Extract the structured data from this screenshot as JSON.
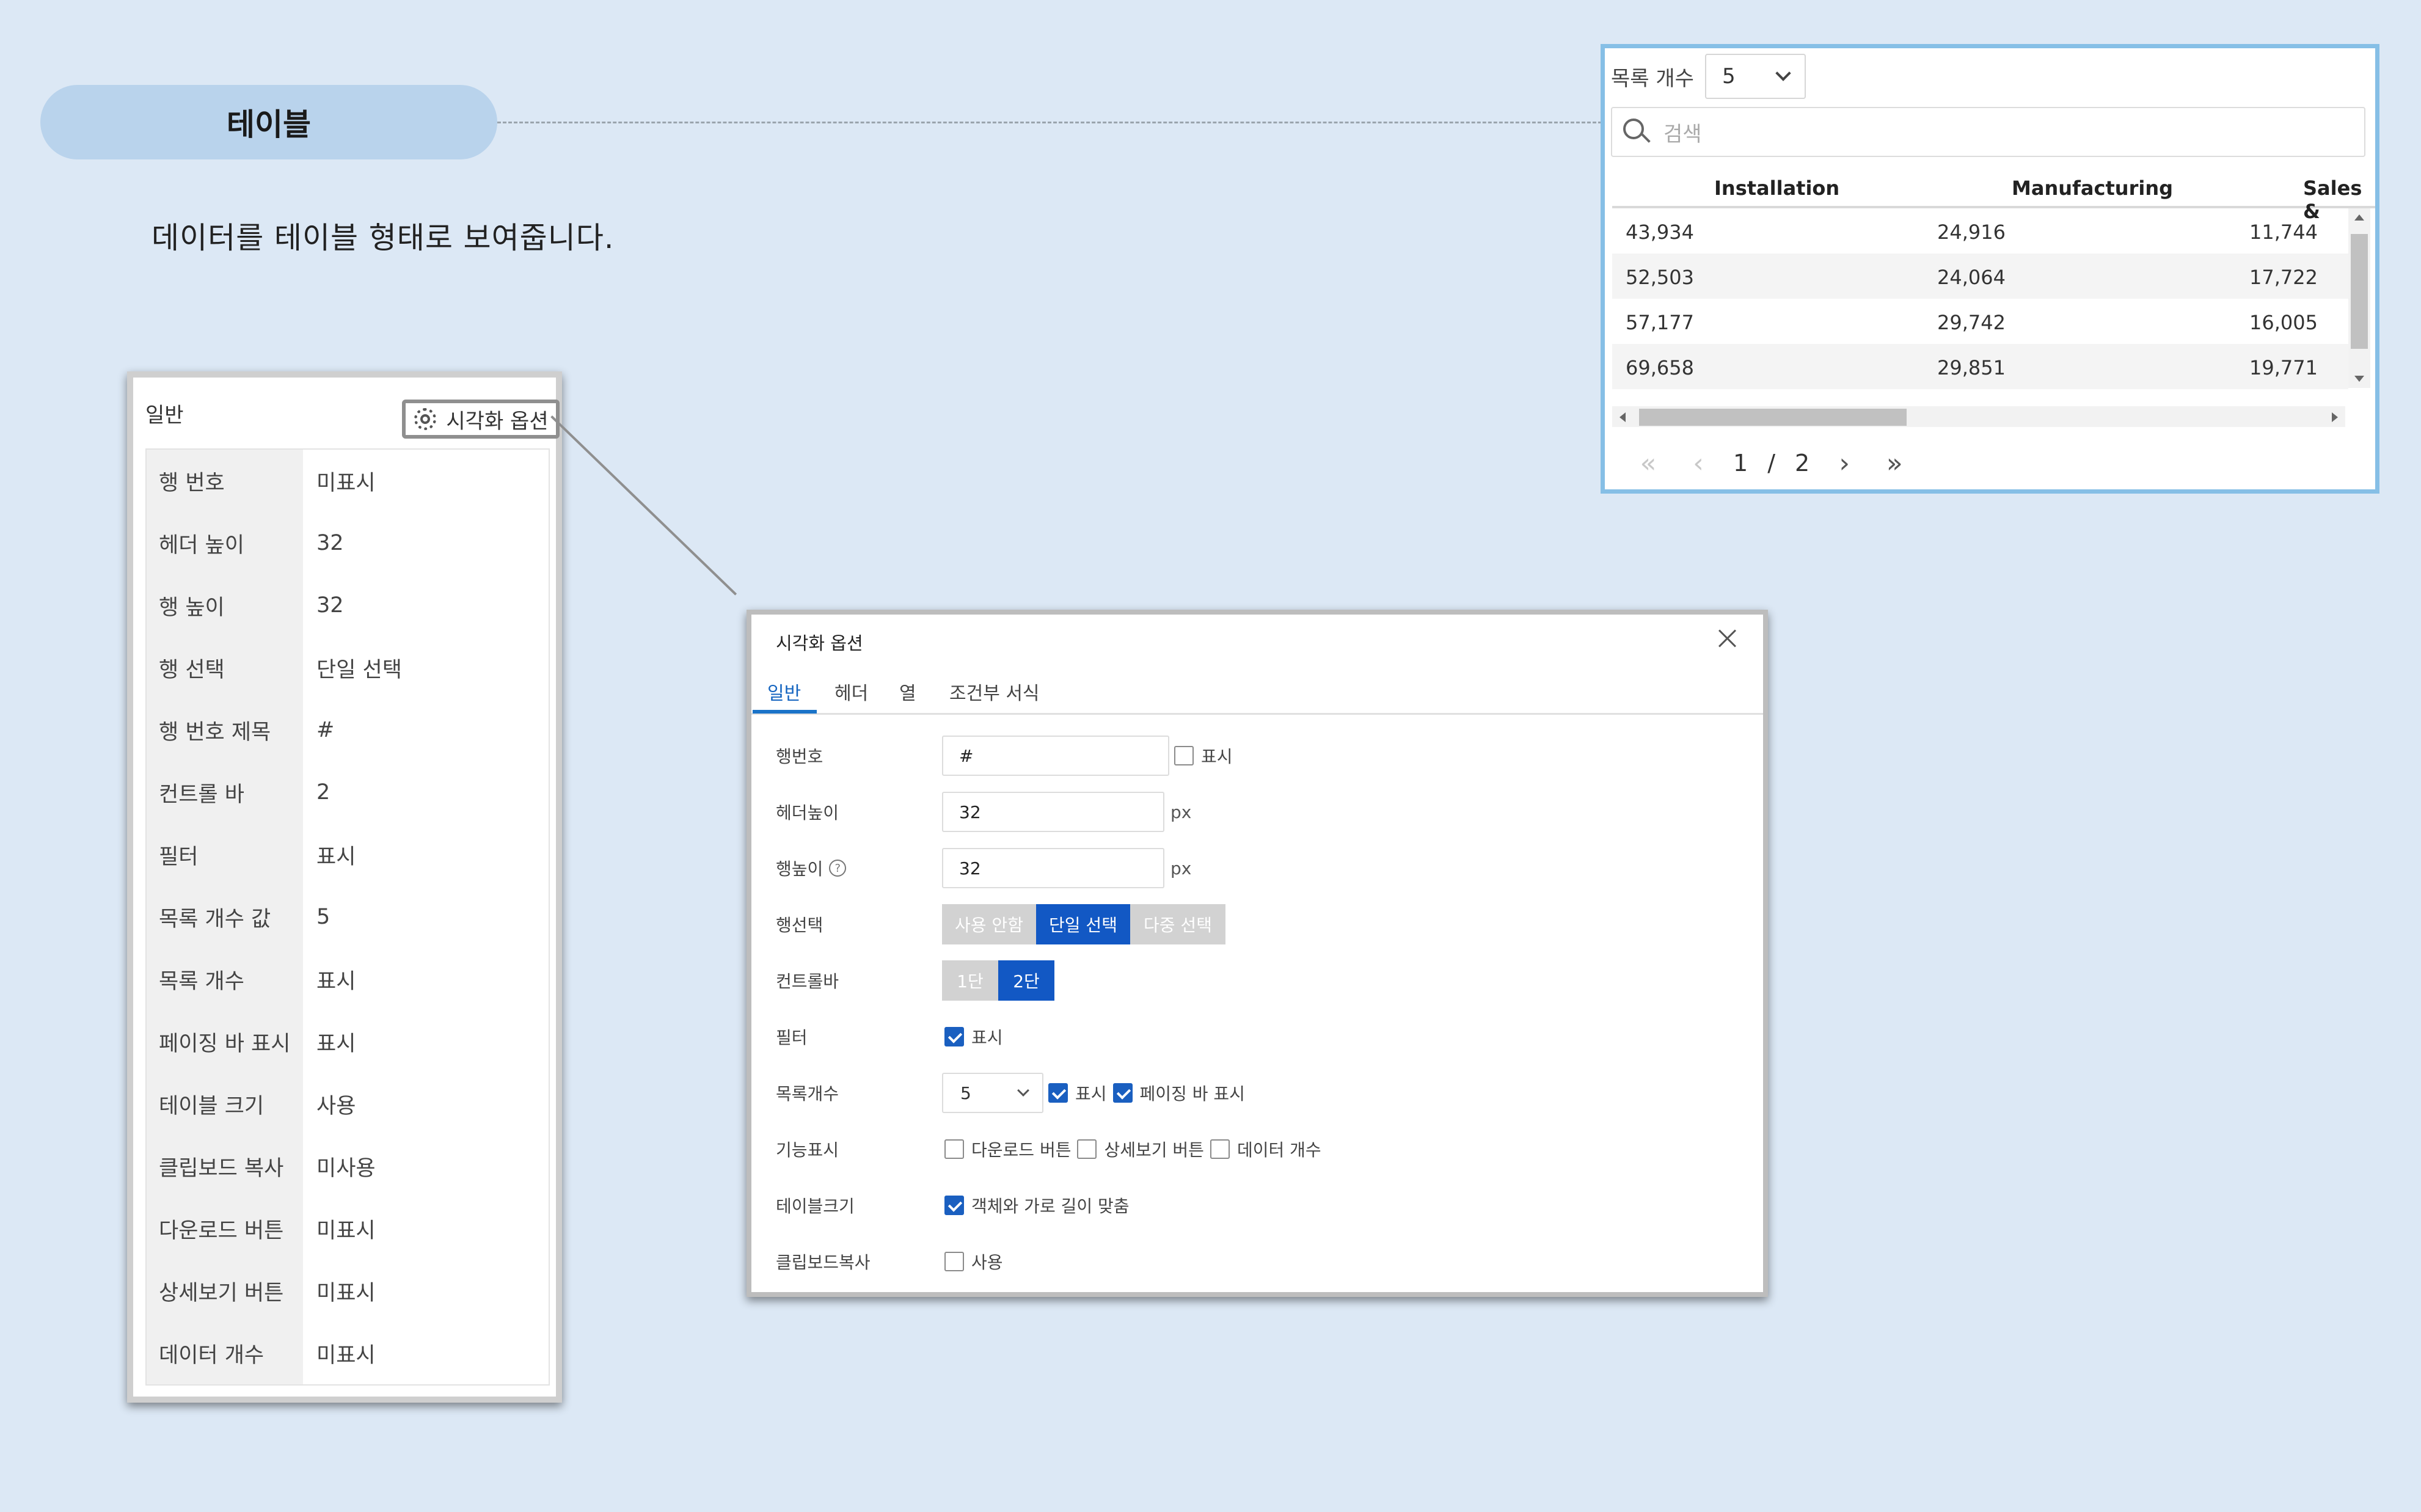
{
  "header": {
    "title": "테이블",
    "description": "데이터를 테이블 형태로 보여줍니다."
  },
  "table_preview": {
    "page_size_label": "목록 개수",
    "page_size_value": "5",
    "search_placeholder": "검색",
    "columns": [
      "Installation",
      "Manufacturing",
      "Sales &"
    ],
    "rows": [
      [
        "43,934",
        "24,916",
        "11,744"
      ],
      [
        "52,503",
        "24,064",
        "17,722"
      ],
      [
        "57,177",
        "29,742",
        "16,005"
      ],
      [
        "69,658",
        "29,851",
        "19,771"
      ]
    ],
    "pager": {
      "current": "1",
      "separator": "/",
      "total": "2"
    }
  },
  "general_panel": {
    "title": "일반",
    "options_button": "시각화 옵션",
    "rows": [
      {
        "key": "행 번호",
        "value": "미표시"
      },
      {
        "key": "헤더 높이",
        "value": "32"
      },
      {
        "key": "행 높이",
        "value": "32"
      },
      {
        "key": "행 선택",
        "value": "단일 선택"
      },
      {
        "key": "행 번호 제목",
        "value": "#"
      },
      {
        "key": "컨트롤 바",
        "value": "2"
      },
      {
        "key": "필터",
        "value": "표시"
      },
      {
        "key": "목록 개수 값",
        "value": "5"
      },
      {
        "key": "목록 개수",
        "value": "표시"
      },
      {
        "key": "페이징 바 표시",
        "value": "표시"
      },
      {
        "key": "테이블 크기",
        "value": "사용"
      },
      {
        "key": "클립보드 복사",
        "value": "미사용"
      },
      {
        "key": "다운로드 버튼",
        "value": "미표시"
      },
      {
        "key": "상세보기 버튼",
        "value": "미표시"
      },
      {
        "key": "데이터 개수",
        "value": "미표시"
      }
    ]
  },
  "dialog": {
    "title": "시각화 옵션",
    "tabs": [
      "일반",
      "헤더",
      "열",
      "조건부 서식"
    ],
    "active_tab": "일반",
    "fields": {
      "row_number": {
        "label": "행번호",
        "value": "#",
        "check_label": "표시",
        "checked": false
      },
      "header_height": {
        "label": "헤더높이",
        "value": "32",
        "unit": "px"
      },
      "row_height": {
        "label": "행높이",
        "help": "?",
        "value": "32",
        "unit": "px"
      },
      "row_select": {
        "label": "행선택",
        "options": [
          "사용 안함",
          "단일 선택",
          "다중 선택"
        ],
        "selected": "단일 선택"
      },
      "control_bar": {
        "label": "컨트롤바",
        "options": [
          "1단",
          "2단"
        ],
        "selected": "2단"
      },
      "filter": {
        "label": "필터",
        "check_label": "표시",
        "checked": true
      },
      "page_size": {
        "label": "목록개수",
        "value": "5",
        "show_label": "표시",
        "show_checked": true,
        "paging_label": "페이징 바 표시",
        "paging_checked": true
      },
      "features": {
        "label": "기능표시",
        "items": [
          {
            "label": "다운로드 버튼",
            "checked": false
          },
          {
            "label": "상세보기 버튼",
            "checked": false
          },
          {
            "label": "데이터 개수",
            "checked": false
          }
        ]
      },
      "table_size": {
        "label": "테이블크기",
        "check_label": "객체와 가로 길이 맞춤",
        "checked": true
      },
      "clipboard": {
        "label": "클립보드복사",
        "check_label": "사용",
        "checked": false
      }
    }
  },
  "colors": {
    "background": "#dce8f5",
    "pill": "#b9d3ec",
    "accent": "#1258c4",
    "preview_border": "#86bfe6"
  }
}
